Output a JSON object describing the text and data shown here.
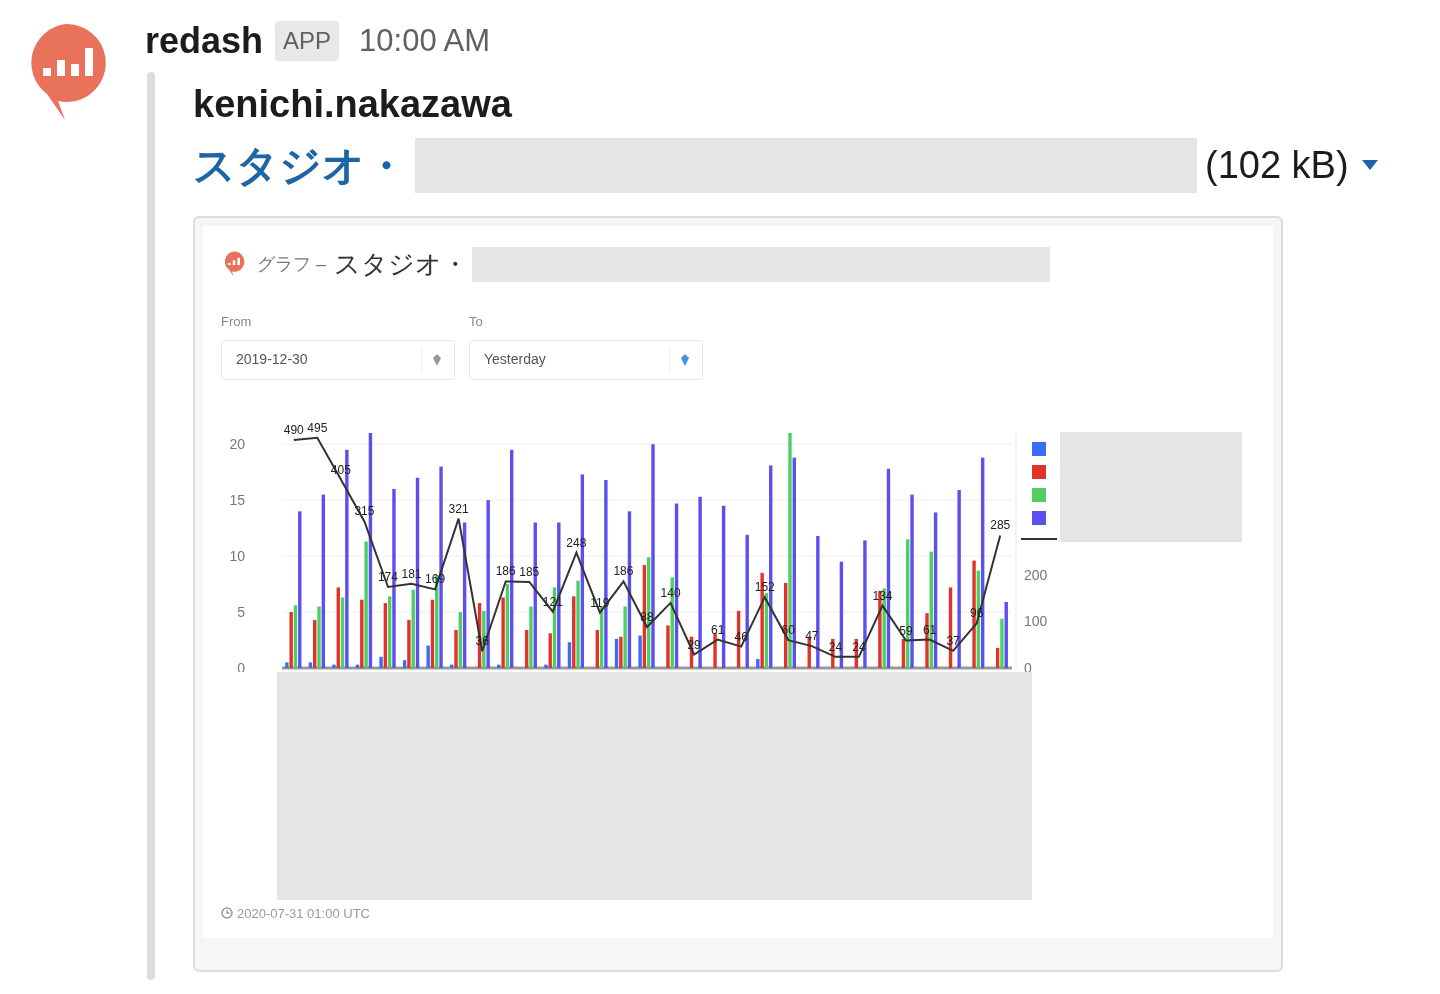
{
  "message": {
    "sender": "redash",
    "badge": "APP",
    "time": "10:00 AM",
    "author": "kenichi.nakazawa",
    "file_title": "スタジオ・",
    "file_size": "(102 kB)"
  },
  "preview": {
    "prefix": "グラフ –",
    "title": "スタジオ・",
    "filters": [
      {
        "label": "From",
        "value": "2019-12-30",
        "kind": "date"
      },
      {
        "label": "To",
        "value": "Yesterday",
        "kind": "dynamic"
      }
    ],
    "charts": [
      {
        "chart_data": {
          "type": "bar",
          "ylim": [
            0,
            21
          ],
          "yticks": [
            0,
            5,
            10,
            15,
            20
          ],
          "grid": true,
          "series": [
            {
              "color": "#3b6cf5",
              "values": [
                0.5,
                0.5,
                0.3,
                0.3,
                1,
                0.7,
                2,
                0.3,
                0,
                0.3,
                0,
                0.3,
                2.3,
                0,
                2.6,
                2.9,
                0,
                0,
                0,
                0,
                0.8,
                0,
                0,
                0,
                0,
                0,
                0,
                0,
                0,
                0,
                0
              ]
            },
            {
              "color": "#e0342b",
              "values": [
                5,
                4.3,
                7.2,
                6.1,
                5.8,
                4.3,
                6.1,
                3.4,
                5.8,
                6.3,
                3.4,
                3.1,
                6.4,
                3.4,
                2.8,
                9.2,
                3.8,
                2.8,
                3.1,
                5.1,
                8.5,
                7.6,
                2.8,
                2.6,
                2.6,
                6.9,
                2.6,
                4.9,
                7.2,
                9.6,
                1.8
              ]
            },
            {
              "color": "#4fcf62",
              "values": [
                5.6,
                5.5,
                6.3,
                11.3,
                6.4,
                7,
                8.3,
                5,
                5.1,
                7.5,
                5.5,
                7.2,
                7.8,
                5.5,
                5.5,
                9.9,
                8.1,
                0,
                0,
                0,
                6.7,
                21,
                0,
                0,
                0,
                7.1,
                11.5,
                10.4,
                0,
                8.7,
                4.4
              ]
            },
            {
              "color": "#5b4ff0",
              "values": [
                14,
                15.5,
                19.5,
                21,
                16,
                17,
                18,
                13,
                15,
                19.5,
                13,
                13,
                17.3,
                16.8,
                14,
                20,
                14.7,
                15.3,
                14.5,
                11.9,
                18.1,
                18.8,
                11.8,
                9.5,
                11.4,
                17.8,
                15.5,
                13.9,
                15.9,
                18.8,
                5.9
              ]
            }
          ]
        }
      },
      {
        "chart_data": {
          "type": "line",
          "ylim": [
            0,
            505
          ],
          "yticks": [
            0,
            100,
            200
          ],
          "data_labels": true,
          "series": [
            {
              "color": "#333333",
              "values": [
                490,
                495,
                405,
                315,
                174,
                181,
                169,
                321,
                36,
                186,
                185,
                121,
                248,
                119,
                186,
                88,
                140,
                29,
                61,
                46,
                152,
                60,
                47,
                24,
                24,
                134,
                59,
                61,
                37,
                96,
                285
              ]
            }
          ]
        }
      }
    ],
    "footer": "2020-07-31 01:00 UTC"
  }
}
